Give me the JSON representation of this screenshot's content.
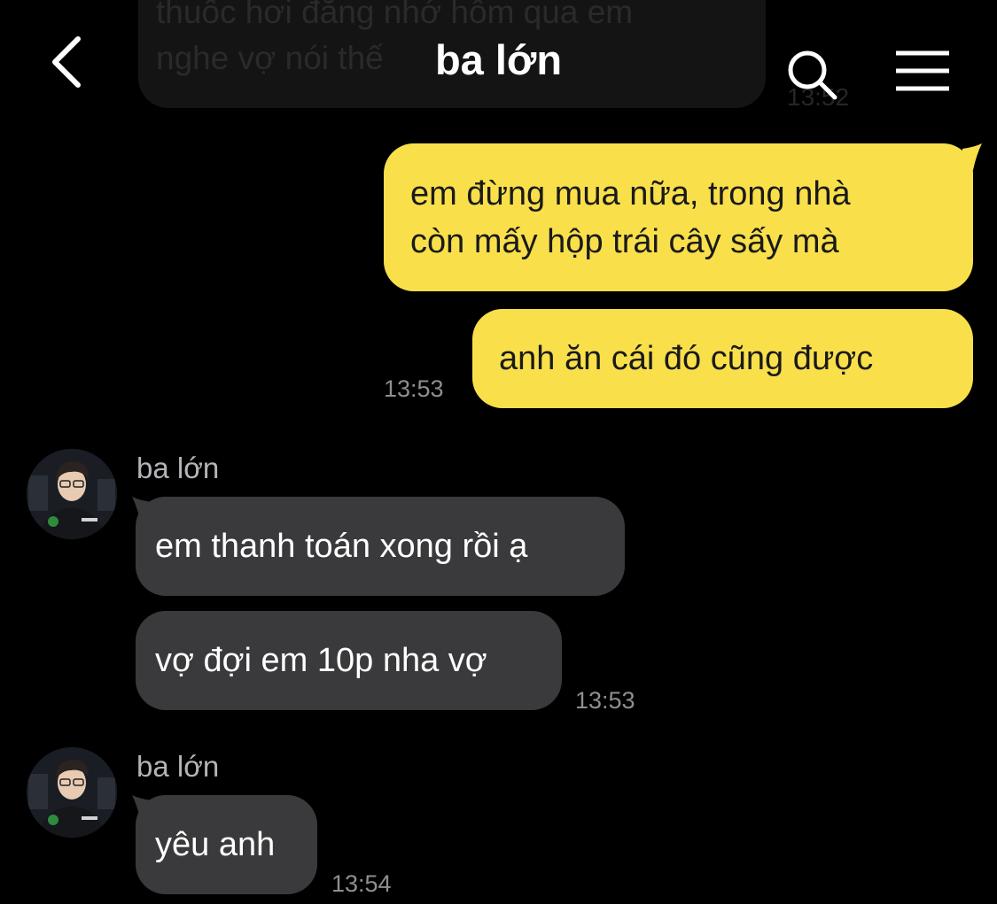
{
  "header": {
    "title": "ba lớn",
    "back_icon": "chevron-left-icon",
    "search_icon": "search-icon",
    "menu_icon": "hamburger-menu-icon"
  },
  "previous_message": {
    "text": "thuốc hơi đắng nhớ hôm qua em\nnghe vợ nói thế",
    "time": "13:52"
  },
  "messages": {
    "out_1": "em đừng mua nữa, trong nhà\ncòn mấy hộp trái cây sấy mà",
    "out_2": "anh ăn cái đó cũng được",
    "out_time": "13:53",
    "group_1": {
      "sender": "ba lớn",
      "msg_1": "em thanh toán xong rồi ạ",
      "msg_2": "vợ đợi em 10p nha vợ",
      "time": "13:53"
    },
    "group_2": {
      "sender": "ba lớn",
      "msg_1": "yêu anh",
      "time": "13:54"
    }
  },
  "colors": {
    "background": "#000000",
    "outgoing_bubble": "#f9e04b",
    "incoming_bubble": "#3a3a3c",
    "timestamp": "#8e8e93"
  }
}
